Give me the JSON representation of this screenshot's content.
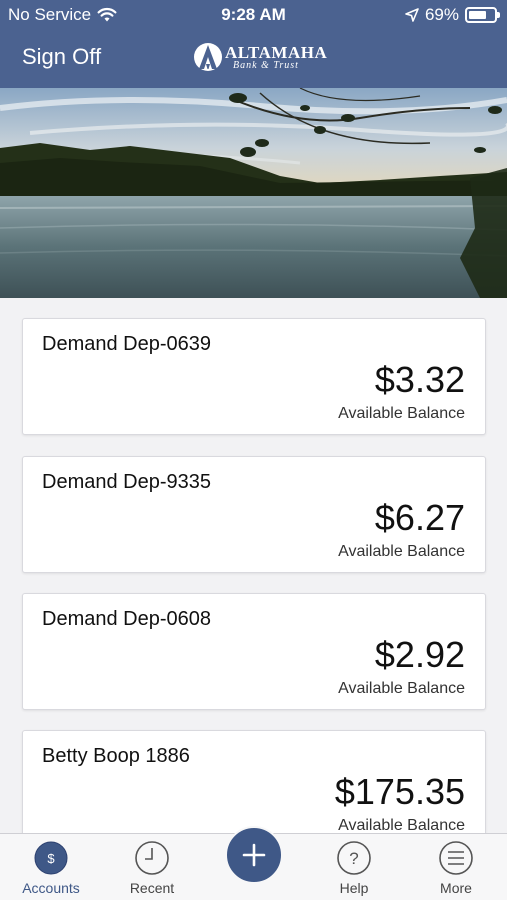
{
  "status_bar": {
    "carrier": "No Service",
    "time": "9:28 AM",
    "battery_percent": "69%",
    "battery_level": 0.69,
    "icons": [
      "wifi-icon",
      "location-arrow-icon",
      "battery-icon"
    ]
  },
  "header": {
    "sign_off_label": "Sign Off",
    "logo": {
      "name": "ALTAMAHA",
      "subtitle": "Bank & Trust"
    }
  },
  "accounts": [
    {
      "name": "Demand Dep-0639",
      "balance": "$3.32",
      "balance_label": "Available Balance"
    },
    {
      "name": "Demand Dep-9335",
      "balance": "$6.27",
      "balance_label": "Available Balance"
    },
    {
      "name": "Demand Dep-0608",
      "balance": "$2.92",
      "balance_label": "Available Balance"
    },
    {
      "name": "Betty Boop 1886",
      "balance": "$175.35",
      "balance_label": "Available Balance"
    }
  ],
  "tab_bar": {
    "tabs": [
      {
        "label": "Accounts",
        "icon": "dollar-circle-icon",
        "active": true
      },
      {
        "label": "Recent",
        "icon": "clock-icon",
        "active": false
      },
      {
        "label": "Help",
        "icon": "question-circle-icon",
        "active": false
      },
      {
        "label": "More",
        "icon": "menu-lines-icon",
        "active": false
      }
    ],
    "center_action_icon": "plus-icon"
  },
  "colors": {
    "brand": "#4b6290",
    "accent": "#3f5887",
    "background": "#f2f2f4"
  }
}
